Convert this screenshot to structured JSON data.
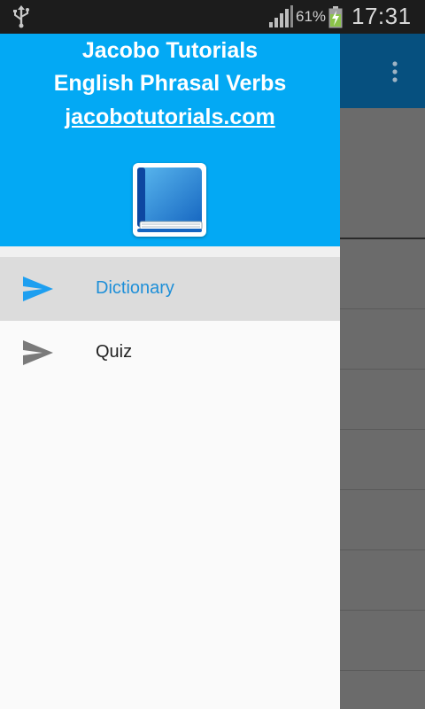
{
  "status_bar": {
    "usb_icon": "usb-icon",
    "signal_icon": "signal-icon",
    "battery_percent": "61%",
    "battery_icon": "battery-charging-icon",
    "time": "17:31"
  },
  "background_app": {
    "toolbar_color": "#06507f",
    "overflow_icon": "overflow-menu-icon"
  },
  "drawer": {
    "header": {
      "title": "Jacobo Tutorials",
      "subtitle": "English Phrasal Verbs",
      "website": "jacobotutorials.com",
      "logo_icon": "book-icon",
      "color": "#03a9f4"
    },
    "items": [
      {
        "label": "Dictionary",
        "icon": "send-icon",
        "active": true
      },
      {
        "label": "Quiz",
        "icon": "send-icon",
        "active": false
      }
    ]
  }
}
